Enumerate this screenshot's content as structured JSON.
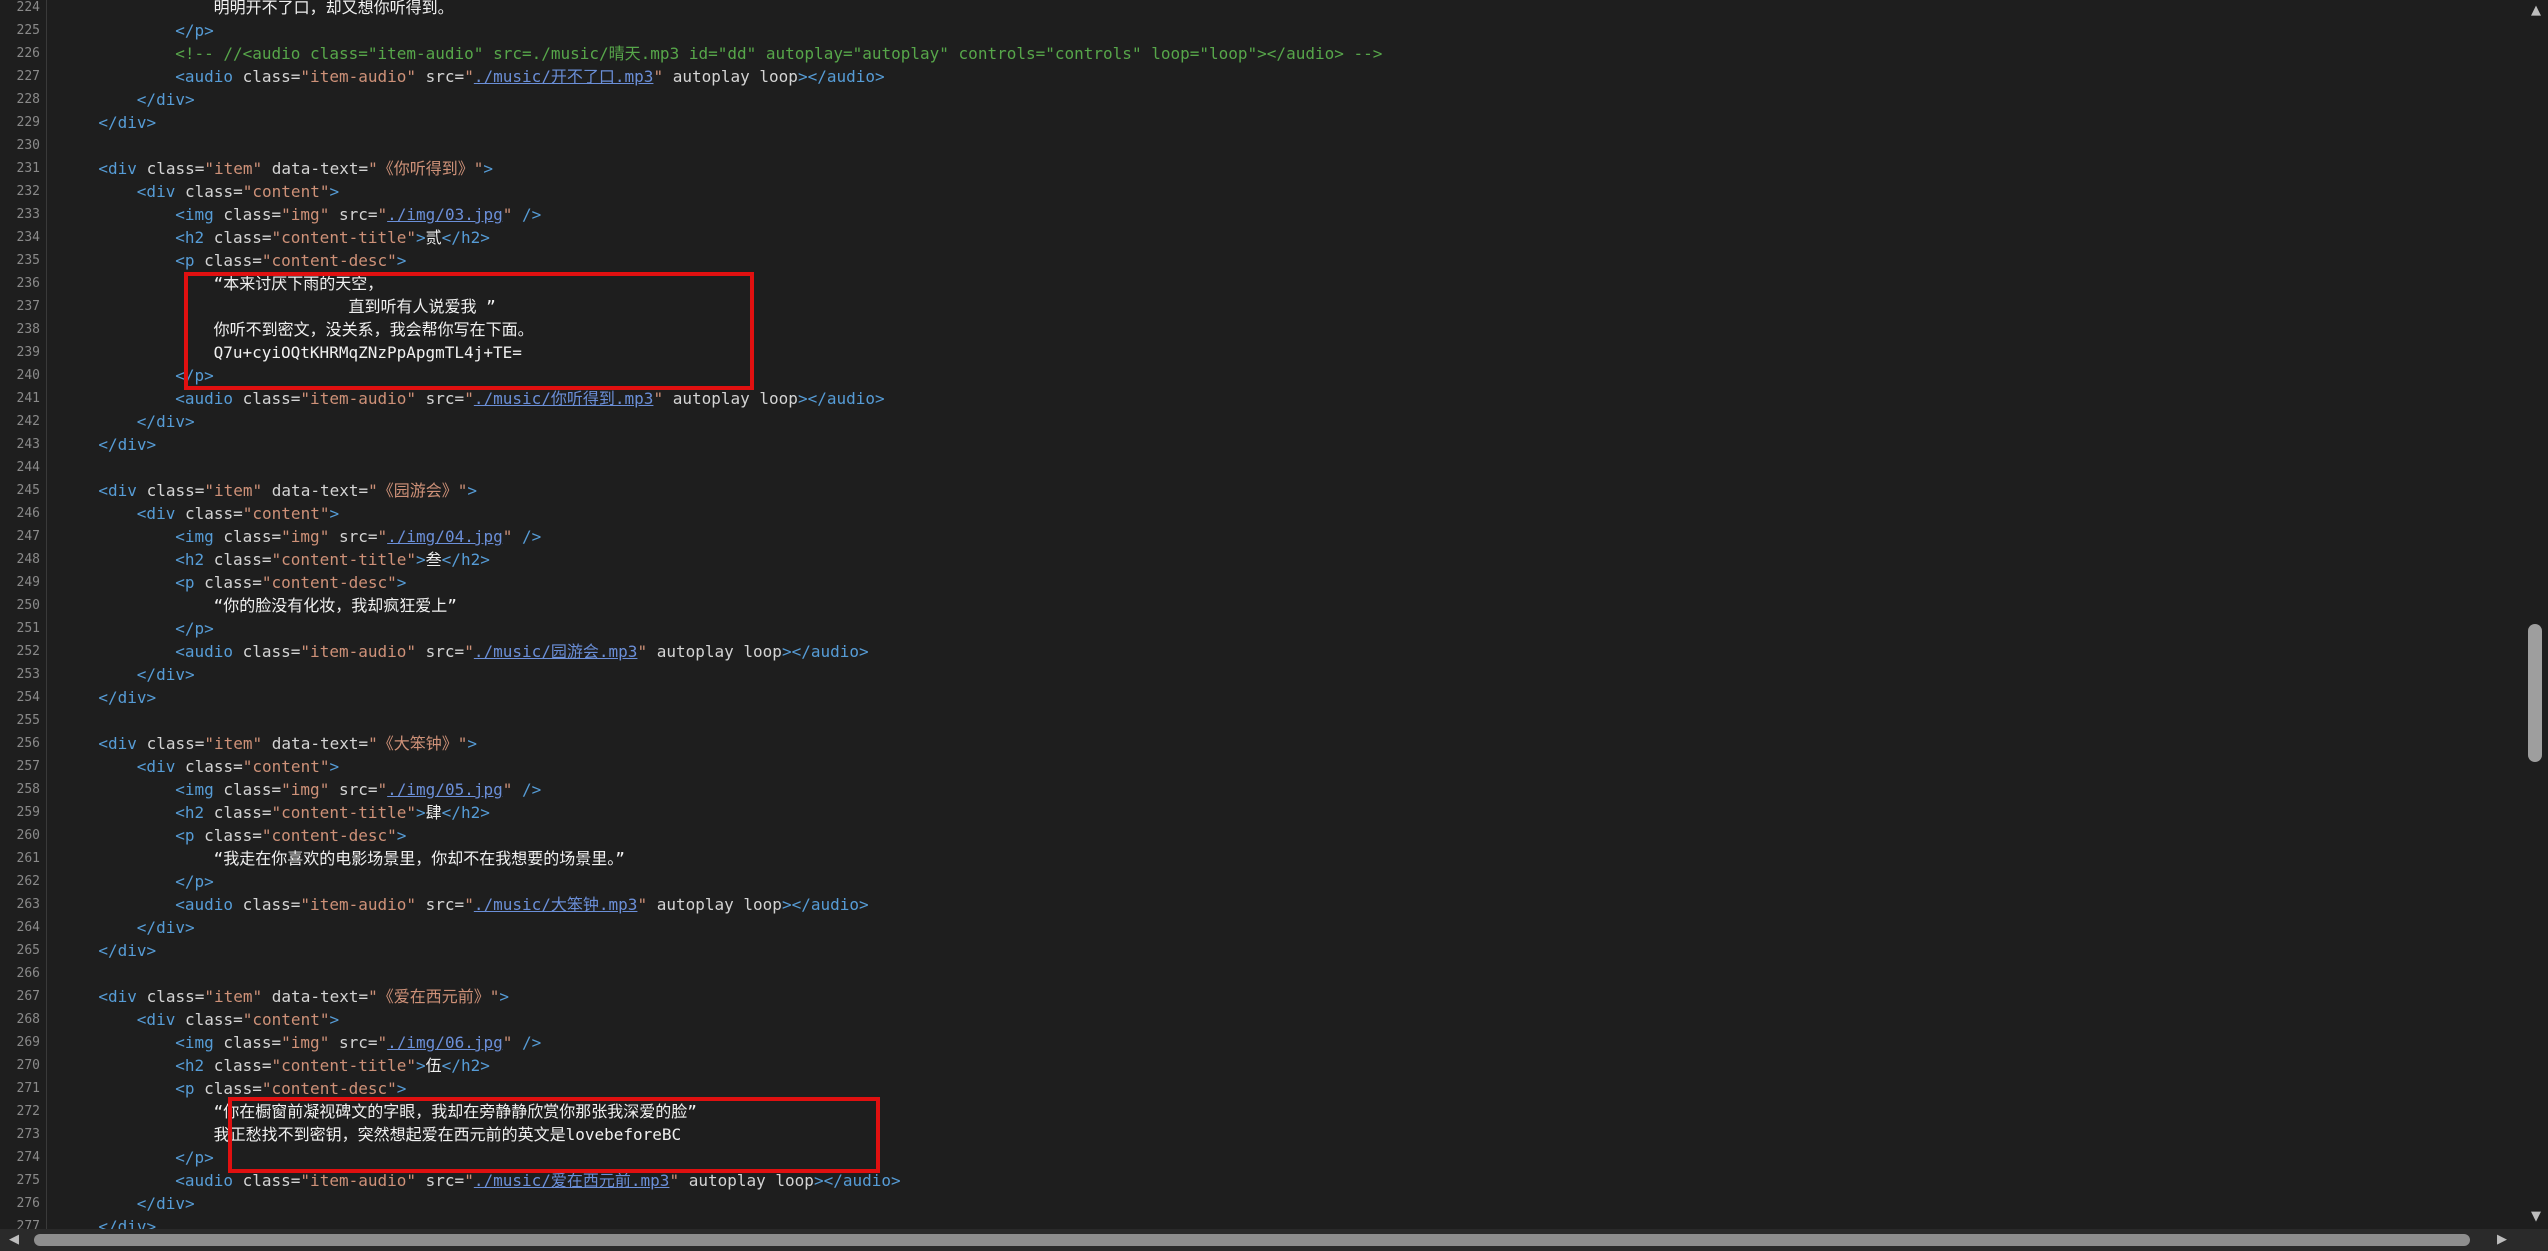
{
  "editor": {
    "lines": [
      {
        "n": "224",
        "indent": 16,
        "parts": [
          {
            "c": "txt",
            "t": "明明开不了口，却又想你听得到。"
          }
        ]
      },
      {
        "n": "225",
        "indent": 12,
        "parts": [
          {
            "c": "tag",
            "t": "</p>"
          }
        ]
      },
      {
        "n": "226",
        "indent": 12,
        "parts": [
          {
            "c": "cmt",
            "t": "<!-- //<audio class=\"item-audio\" src=./music/晴天.mp3 id=\"dd\" autoplay=\"autoplay\" controls=\"controls\" loop=\"loop\"></audio> -->"
          }
        ]
      },
      {
        "n": "227",
        "indent": 12,
        "parts": [
          {
            "c": "tag",
            "t": "<audio "
          },
          {
            "c": "attr",
            "t": "class="
          },
          {
            "c": "val",
            "t": "\"item-audio\""
          },
          {
            "c": "attr",
            "t": " src="
          },
          {
            "c": "val",
            "t": "\""
          },
          {
            "c": "lnk",
            "t": "./music/开不了口.mp3"
          },
          {
            "c": "val",
            "t": "\""
          },
          {
            "c": "attr",
            "t": " autoplay loop"
          },
          {
            "c": "tag",
            "t": "></audio>"
          }
        ]
      },
      {
        "n": "228",
        "indent": 8,
        "parts": [
          {
            "c": "tag",
            "t": "</div>"
          }
        ]
      },
      {
        "n": "229",
        "indent": 4,
        "parts": [
          {
            "c": "tag",
            "t": "</div>"
          }
        ]
      },
      {
        "n": "230",
        "indent": 0,
        "parts": []
      },
      {
        "n": "231",
        "indent": 4,
        "parts": [
          {
            "c": "tag",
            "t": "<div "
          },
          {
            "c": "attr",
            "t": "class="
          },
          {
            "c": "val",
            "t": "\"item\""
          },
          {
            "c": "attr",
            "t": " data-text="
          },
          {
            "c": "val",
            "t": "\"《你听得到》\""
          },
          {
            "c": "tag",
            "t": ">"
          }
        ]
      },
      {
        "n": "232",
        "indent": 8,
        "parts": [
          {
            "c": "tag",
            "t": "<div "
          },
          {
            "c": "attr",
            "t": "class="
          },
          {
            "c": "val",
            "t": "\"content\""
          },
          {
            "c": "tag",
            "t": ">"
          }
        ]
      },
      {
        "n": "233",
        "indent": 12,
        "parts": [
          {
            "c": "tag",
            "t": "<img "
          },
          {
            "c": "attr",
            "t": "class="
          },
          {
            "c": "val",
            "t": "\"img\""
          },
          {
            "c": "attr",
            "t": " src="
          },
          {
            "c": "val",
            "t": "\""
          },
          {
            "c": "lnk",
            "t": "./img/03.jpg"
          },
          {
            "c": "val",
            "t": "\""
          },
          {
            "c": "tag",
            "t": " />"
          }
        ]
      },
      {
        "n": "234",
        "indent": 12,
        "parts": [
          {
            "c": "tag",
            "t": "<h2 "
          },
          {
            "c": "attr",
            "t": "class="
          },
          {
            "c": "val",
            "t": "\"content-title\""
          },
          {
            "c": "tag",
            "t": ">"
          },
          {
            "c": "txt",
            "t": "贰"
          },
          {
            "c": "tag",
            "t": "</h2>"
          }
        ]
      },
      {
        "n": "235",
        "indent": 12,
        "parts": [
          {
            "c": "tag",
            "t": "<p "
          },
          {
            "c": "attr",
            "t": "class="
          },
          {
            "c": "val",
            "t": "\"content-desc\""
          },
          {
            "c": "tag",
            "t": ">"
          }
        ]
      },
      {
        "n": "236",
        "indent": 16,
        "parts": [
          {
            "c": "txt",
            "t": "“本来讨厌下雨的天空，"
          }
        ]
      },
      {
        "n": "237",
        "indent": 16,
        "parts": [
          {
            "c": "txt",
            "t": "              直到听有人说爱我 ”"
          }
        ]
      },
      {
        "n": "238",
        "indent": 16,
        "parts": [
          {
            "c": "txt",
            "t": "你听不到密文，没关系，我会帮你写在下面。"
          }
        ]
      },
      {
        "n": "239",
        "indent": 16,
        "parts": [
          {
            "c": "txt",
            "t": "Q7u+cyiOQtKHRMqZNzPpApgmTL4j+TE="
          }
        ]
      },
      {
        "n": "240",
        "indent": 12,
        "parts": [
          {
            "c": "tag",
            "t": "</p>"
          }
        ]
      },
      {
        "n": "241",
        "indent": 12,
        "parts": [
          {
            "c": "tag",
            "t": "<audio "
          },
          {
            "c": "attr",
            "t": "class="
          },
          {
            "c": "val",
            "t": "\"item-audio\""
          },
          {
            "c": "attr",
            "t": " src="
          },
          {
            "c": "val",
            "t": "\""
          },
          {
            "c": "lnk",
            "t": "./music/你听得到.mp3"
          },
          {
            "c": "val",
            "t": "\""
          },
          {
            "c": "attr",
            "t": " autoplay loop"
          },
          {
            "c": "tag",
            "t": "></audio>"
          }
        ]
      },
      {
        "n": "242",
        "indent": 8,
        "parts": [
          {
            "c": "tag",
            "t": "</div>"
          }
        ]
      },
      {
        "n": "243",
        "indent": 4,
        "parts": [
          {
            "c": "tag",
            "t": "</div>"
          }
        ]
      },
      {
        "n": "244",
        "indent": 0,
        "parts": []
      },
      {
        "n": "245",
        "indent": 4,
        "parts": [
          {
            "c": "tag",
            "t": "<div "
          },
          {
            "c": "attr",
            "t": "class="
          },
          {
            "c": "val",
            "t": "\"item\""
          },
          {
            "c": "attr",
            "t": " data-text="
          },
          {
            "c": "val",
            "t": "\"《园游会》\""
          },
          {
            "c": "tag",
            "t": ">"
          }
        ]
      },
      {
        "n": "246",
        "indent": 8,
        "parts": [
          {
            "c": "tag",
            "t": "<div "
          },
          {
            "c": "attr",
            "t": "class="
          },
          {
            "c": "val",
            "t": "\"content\""
          },
          {
            "c": "tag",
            "t": ">"
          }
        ]
      },
      {
        "n": "247",
        "indent": 12,
        "parts": [
          {
            "c": "tag",
            "t": "<img "
          },
          {
            "c": "attr",
            "t": "class="
          },
          {
            "c": "val",
            "t": "\"img\""
          },
          {
            "c": "attr",
            "t": " src="
          },
          {
            "c": "val",
            "t": "\""
          },
          {
            "c": "lnk",
            "t": "./img/04.jpg"
          },
          {
            "c": "val",
            "t": "\""
          },
          {
            "c": "tag",
            "t": " />"
          }
        ]
      },
      {
        "n": "248",
        "indent": 12,
        "parts": [
          {
            "c": "tag",
            "t": "<h2 "
          },
          {
            "c": "attr",
            "t": "class="
          },
          {
            "c": "val",
            "t": "\"content-title\""
          },
          {
            "c": "tag",
            "t": ">"
          },
          {
            "c": "txt",
            "t": "叁"
          },
          {
            "c": "tag",
            "t": "</h2>"
          }
        ]
      },
      {
        "n": "249",
        "indent": 12,
        "parts": [
          {
            "c": "tag",
            "t": "<p "
          },
          {
            "c": "attr",
            "t": "class="
          },
          {
            "c": "val",
            "t": "\"content-desc\""
          },
          {
            "c": "tag",
            "t": ">"
          }
        ]
      },
      {
        "n": "250",
        "indent": 16,
        "parts": [
          {
            "c": "txt",
            "t": "“你的脸没有化妆，我却疯狂爱上”"
          }
        ]
      },
      {
        "n": "251",
        "indent": 12,
        "parts": [
          {
            "c": "tag",
            "t": "</p>"
          }
        ]
      },
      {
        "n": "252",
        "indent": 12,
        "parts": [
          {
            "c": "tag",
            "t": "<audio "
          },
          {
            "c": "attr",
            "t": "class="
          },
          {
            "c": "val",
            "t": "\"item-audio\""
          },
          {
            "c": "attr",
            "t": " src="
          },
          {
            "c": "val",
            "t": "\""
          },
          {
            "c": "lnk",
            "t": "./music/园游会.mp3"
          },
          {
            "c": "val",
            "t": "\""
          },
          {
            "c": "attr",
            "t": " autoplay loop"
          },
          {
            "c": "tag",
            "t": "></audio>"
          }
        ]
      },
      {
        "n": "253",
        "indent": 8,
        "parts": [
          {
            "c": "tag",
            "t": "</div>"
          }
        ]
      },
      {
        "n": "254",
        "indent": 4,
        "parts": [
          {
            "c": "tag",
            "t": "</div>"
          }
        ]
      },
      {
        "n": "255",
        "indent": 0,
        "parts": []
      },
      {
        "n": "256",
        "indent": 4,
        "parts": [
          {
            "c": "tag",
            "t": "<div "
          },
          {
            "c": "attr",
            "t": "class="
          },
          {
            "c": "val",
            "t": "\"item\""
          },
          {
            "c": "attr",
            "t": " data-text="
          },
          {
            "c": "val",
            "t": "\"《大笨钟》\""
          },
          {
            "c": "tag",
            "t": ">"
          }
        ]
      },
      {
        "n": "257",
        "indent": 8,
        "parts": [
          {
            "c": "tag",
            "t": "<div "
          },
          {
            "c": "attr",
            "t": "class="
          },
          {
            "c": "val",
            "t": "\"content\""
          },
          {
            "c": "tag",
            "t": ">"
          }
        ]
      },
      {
        "n": "258",
        "indent": 12,
        "parts": [
          {
            "c": "tag",
            "t": "<img "
          },
          {
            "c": "attr",
            "t": "class="
          },
          {
            "c": "val",
            "t": "\"img\""
          },
          {
            "c": "attr",
            "t": " src="
          },
          {
            "c": "val",
            "t": "\""
          },
          {
            "c": "lnk",
            "t": "./img/05.jpg"
          },
          {
            "c": "val",
            "t": "\""
          },
          {
            "c": "tag",
            "t": " />"
          }
        ]
      },
      {
        "n": "259",
        "indent": 12,
        "parts": [
          {
            "c": "tag",
            "t": "<h2 "
          },
          {
            "c": "attr",
            "t": "class="
          },
          {
            "c": "val",
            "t": "\"content-title\""
          },
          {
            "c": "tag",
            "t": ">"
          },
          {
            "c": "txt",
            "t": "肆"
          },
          {
            "c": "tag",
            "t": "</h2>"
          }
        ]
      },
      {
        "n": "260",
        "indent": 12,
        "parts": [
          {
            "c": "tag",
            "t": "<p "
          },
          {
            "c": "attr",
            "t": "class="
          },
          {
            "c": "val",
            "t": "\"content-desc\""
          },
          {
            "c": "tag",
            "t": ">"
          }
        ]
      },
      {
        "n": "261",
        "indent": 16,
        "parts": [
          {
            "c": "txt",
            "t": "“我走在你喜欢的电影场景里，你却不在我想要的场景里。”"
          }
        ]
      },
      {
        "n": "262",
        "indent": 12,
        "parts": [
          {
            "c": "tag",
            "t": "</p>"
          }
        ]
      },
      {
        "n": "263",
        "indent": 12,
        "parts": [
          {
            "c": "tag",
            "t": "<audio "
          },
          {
            "c": "attr",
            "t": "class="
          },
          {
            "c": "val",
            "t": "\"item-audio\""
          },
          {
            "c": "attr",
            "t": " src="
          },
          {
            "c": "val",
            "t": "\""
          },
          {
            "c": "lnk",
            "t": "./music/大笨钟.mp3"
          },
          {
            "c": "val",
            "t": "\""
          },
          {
            "c": "attr",
            "t": " autoplay loop"
          },
          {
            "c": "tag",
            "t": "></audio>"
          }
        ]
      },
      {
        "n": "264",
        "indent": 8,
        "parts": [
          {
            "c": "tag",
            "t": "</div>"
          }
        ]
      },
      {
        "n": "265",
        "indent": 4,
        "parts": [
          {
            "c": "tag",
            "t": "</div>"
          }
        ]
      },
      {
        "n": "266",
        "indent": 0,
        "parts": []
      },
      {
        "n": "267",
        "indent": 4,
        "parts": [
          {
            "c": "tag",
            "t": "<div "
          },
          {
            "c": "attr",
            "t": "class="
          },
          {
            "c": "val",
            "t": "\"item\""
          },
          {
            "c": "attr",
            "t": " data-text="
          },
          {
            "c": "val",
            "t": "\"《爱在西元前》\""
          },
          {
            "c": "tag",
            "t": ">"
          }
        ]
      },
      {
        "n": "268",
        "indent": 8,
        "parts": [
          {
            "c": "tag",
            "t": "<div "
          },
          {
            "c": "attr",
            "t": "class="
          },
          {
            "c": "val",
            "t": "\"content\""
          },
          {
            "c": "tag",
            "t": ">"
          }
        ]
      },
      {
        "n": "269",
        "indent": 12,
        "parts": [
          {
            "c": "tag",
            "t": "<img "
          },
          {
            "c": "attr",
            "t": "class="
          },
          {
            "c": "val",
            "t": "\"img\""
          },
          {
            "c": "attr",
            "t": " src="
          },
          {
            "c": "val",
            "t": "\""
          },
          {
            "c": "lnk",
            "t": "./img/06.jpg"
          },
          {
            "c": "val",
            "t": "\""
          },
          {
            "c": "tag",
            "t": " />"
          }
        ]
      },
      {
        "n": "270",
        "indent": 12,
        "parts": [
          {
            "c": "tag",
            "t": "<h2 "
          },
          {
            "c": "attr",
            "t": "class="
          },
          {
            "c": "val",
            "t": "\"content-title\""
          },
          {
            "c": "tag",
            "t": ">"
          },
          {
            "c": "txt",
            "t": "伍"
          },
          {
            "c": "tag",
            "t": "</h2>"
          }
        ]
      },
      {
        "n": "271",
        "indent": 12,
        "parts": [
          {
            "c": "tag",
            "t": "<p "
          },
          {
            "c": "attr",
            "t": "class="
          },
          {
            "c": "val",
            "t": "\"content-desc\""
          },
          {
            "c": "tag",
            "t": ">"
          }
        ]
      },
      {
        "n": "272",
        "indent": 16,
        "parts": [
          {
            "c": "txt",
            "t": "“你在橱窗前凝视碑文的字眼，我却在旁静静欣赏你那张我深爱的脸”"
          }
        ]
      },
      {
        "n": "273",
        "indent": 16,
        "parts": [
          {
            "c": "txt",
            "t": "我正愁找不到密钥，突然想起爱在西元前的英文是lovebeforeBC"
          }
        ]
      },
      {
        "n": "274",
        "indent": 12,
        "parts": [
          {
            "c": "tag",
            "t": "</p>"
          }
        ]
      },
      {
        "n": "275",
        "indent": 12,
        "parts": [
          {
            "c": "tag",
            "t": "<audio "
          },
          {
            "c": "attr",
            "t": "class="
          },
          {
            "c": "val",
            "t": "\"item-audio\""
          },
          {
            "c": "attr",
            "t": " src="
          },
          {
            "c": "val",
            "t": "\""
          },
          {
            "c": "lnk",
            "t": "./music/爱在西元前.mp3"
          },
          {
            "c": "val",
            "t": "\""
          },
          {
            "c": "attr",
            "t": " autoplay loop"
          },
          {
            "c": "tag",
            "t": "></audio>"
          }
        ]
      },
      {
        "n": "276",
        "indent": 8,
        "parts": [
          {
            "c": "tag",
            "t": "</div>"
          }
        ]
      },
      {
        "n": "277",
        "indent": 4,
        "parts": [
          {
            "c": "tag",
            "t": "</div>"
          }
        ]
      }
    ]
  },
  "highlight_color": "#e01010",
  "scrollbar": {
    "vertical_position": 0.55,
    "up_arrow_icon": "arrow-up-icon",
    "down_arrow_icon": "arrow-down-icon",
    "left_arrow_icon": "arrow-left-icon",
    "right_arrow_icon": "arrow-right-icon"
  }
}
